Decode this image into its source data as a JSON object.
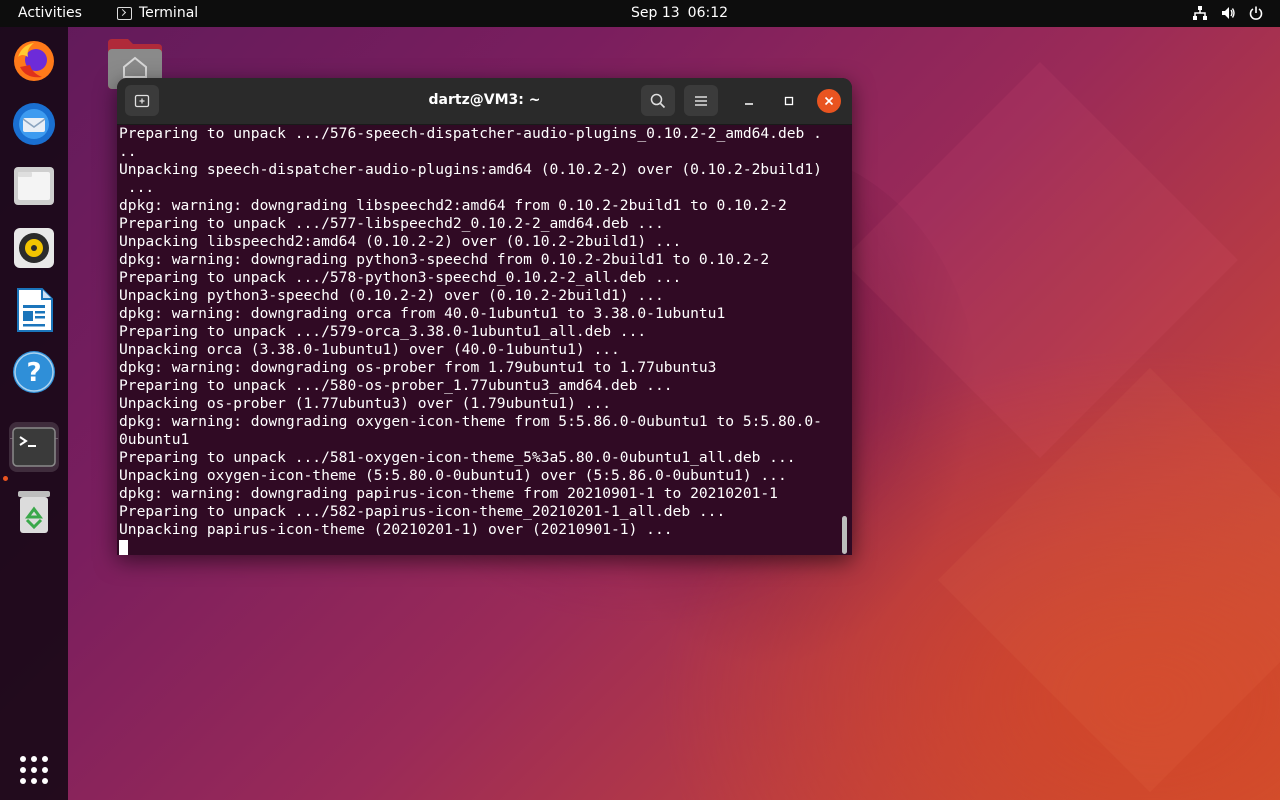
{
  "topbar": {
    "activities": "Activities",
    "app_name": "Terminal",
    "date": "Sep 13",
    "time": "06:12",
    "tray_icons": [
      "network-icon",
      "volume-icon",
      "power-icon"
    ]
  },
  "dock": {
    "apps": [
      {
        "name": "firefox-icon",
        "label": "Firefox"
      },
      {
        "name": "thunderbird-icon",
        "label": "Thunderbird"
      },
      {
        "name": "files-icon",
        "label": "Files"
      },
      {
        "name": "rhythmbox-icon",
        "label": "Rhythmbox"
      },
      {
        "name": "libreoffice-writer-icon",
        "label": "LibreOffice Writer"
      },
      {
        "name": "help-icon",
        "label": "Help"
      },
      {
        "name": "terminal-icon",
        "label": "Terminal",
        "active": true
      },
      {
        "name": "trash-icon",
        "label": "Trash"
      }
    ],
    "show_apps_icon": "app-grid-icon"
  },
  "terminal": {
    "title": "dartz@VM3: ~",
    "lines": [
      "Preparing to unpack .../576-speech-dispatcher-audio-plugins_0.10.2-2_amd64.deb .",
      "..",
      "Unpacking speech-dispatcher-audio-plugins:amd64 (0.10.2-2) over (0.10.2-2build1)",
      " ...",
      "dpkg: warning: downgrading libspeechd2:amd64 from 0.10.2-2build1 to 0.10.2-2",
      "Preparing to unpack .../577-libspeechd2_0.10.2-2_amd64.deb ...",
      "Unpacking libspeechd2:amd64 (0.10.2-2) over (0.10.2-2build1) ...",
      "dpkg: warning: downgrading python3-speechd from 0.10.2-2build1 to 0.10.2-2",
      "Preparing to unpack .../578-python3-speechd_0.10.2-2_all.deb ...",
      "Unpacking python3-speechd (0.10.2-2) over (0.10.2-2build1) ...",
      "dpkg: warning: downgrading orca from 40.0-1ubuntu1 to 3.38.0-1ubuntu1",
      "Preparing to unpack .../579-orca_3.38.0-1ubuntu1_all.deb ...",
      "Unpacking orca (3.38.0-1ubuntu1) over (40.0-1ubuntu1) ...",
      "dpkg: warning: downgrading os-prober from 1.79ubuntu1 to 1.77ubuntu3",
      "Preparing to unpack .../580-os-prober_1.77ubuntu3_amd64.deb ...",
      "Unpacking os-prober (1.77ubuntu3) over (1.79ubuntu1) ...",
      "dpkg: warning: downgrading oxygen-icon-theme from 5:5.86.0-0ubuntu1 to 5:5.80.0-",
      "0ubuntu1",
      "Preparing to unpack .../581-oxygen-icon-theme_5%3a5.80.0-0ubuntu1_all.deb ...",
      "Unpacking oxygen-icon-theme (5:5.80.0-0ubuntu1) over (5:5.86.0-0ubuntu1) ...",
      "dpkg: warning: downgrading papirus-icon-theme from 20210901-1 to 20210201-1",
      "Preparing to unpack .../582-papirus-icon-theme_20210201-1_all.deb ...",
      "Unpacking papirus-icon-theme (20210201-1) over (20210901-1) ..."
    ]
  },
  "colors": {
    "terminal_bg": "#300a24",
    "accent": "#e95420",
    "titlebar": "#2a2a2a"
  }
}
